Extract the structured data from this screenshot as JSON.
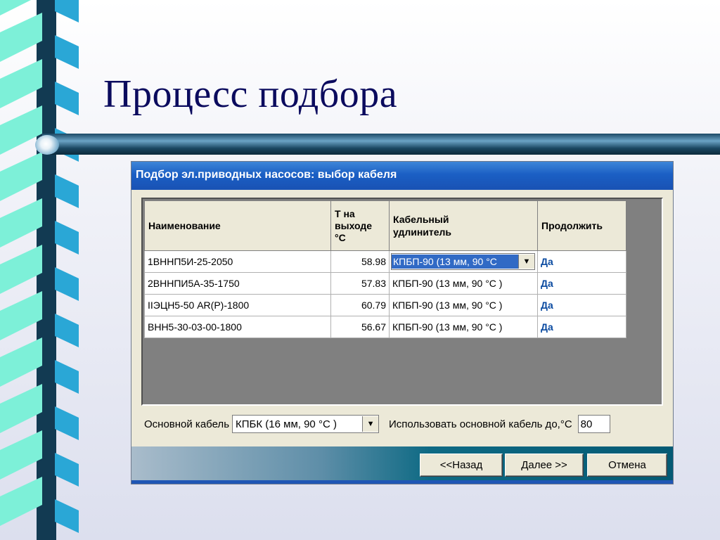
{
  "slide": {
    "title": "Процесс подбора"
  },
  "dialog": {
    "title": "Подбор эл.приводных насосов: выбор кабеля",
    "columns": {
      "name": "Наименование",
      "temp": "Т на выходе °С",
      "cable": "Кабельный удлинитель",
      "continue": "Продолжить"
    },
    "rows": [
      {
        "name": "1ВННП5И-25-2050",
        "temp": "58.98",
        "cable": "КПБП-90 (13 мм, 90 °С",
        "continue": "Да"
      },
      {
        "name": "2ВННПИ5А-35-1750",
        "temp": "57.83",
        "cable": "КПБП-90 (13 мм, 90 °С )",
        "continue": "Да"
      },
      {
        "name": "IIЭЦН5-50 АR(P)-1800",
        "temp": "60.79",
        "cable": "КПБП-90 (13 мм, 90 °С )",
        "continue": "Да"
      },
      {
        "name": "ВНН5-30-03-00-1800",
        "temp": "56.67",
        "cable": "КПБП-90 (13 мм, 90 °С )",
        "continue": "Да"
      }
    ],
    "main_cable_label": "Основной кабель",
    "main_cable_value": "КПБК (16 мм, 90 °С )",
    "use_main_label": "Использовать основной кабель до,°С",
    "use_main_value": "80",
    "buttons": {
      "back": "<<Назад",
      "next": "Далее >>",
      "cancel": "Отмена"
    }
  },
  "colors": {
    "title": "#0b0b5e",
    "spiral_dark": "#0d3b57",
    "spiral_light": "#7df0d8",
    "spiral_mid": "#2aa7d6"
  }
}
